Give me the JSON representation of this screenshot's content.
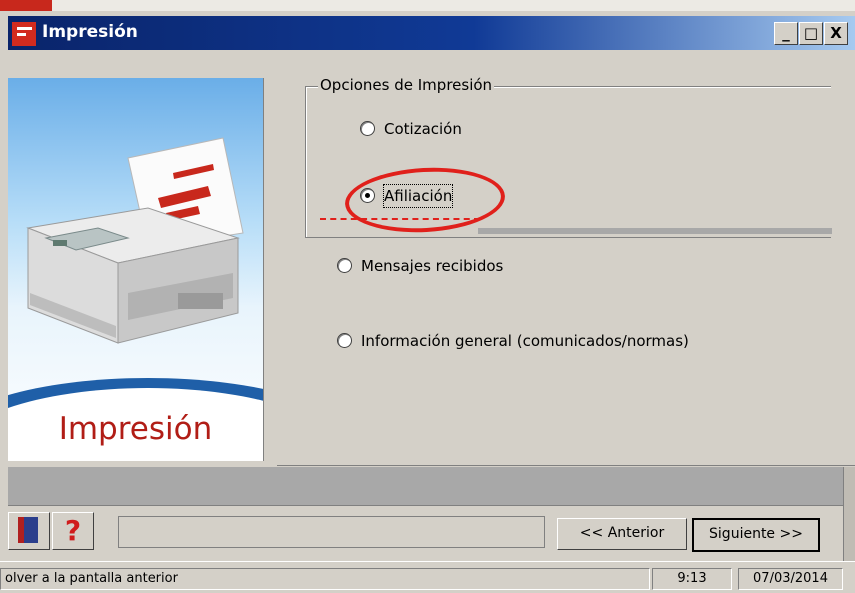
{
  "window": {
    "title": "Impresión",
    "controls": {
      "minimize": "_",
      "maximize": "□",
      "close": "X"
    }
  },
  "side_panel": {
    "title": "Impresión"
  },
  "options_group": {
    "label": "Opciones de Impresión",
    "options": [
      {
        "label": "Cotización",
        "selected": false
      },
      {
        "label": "Afiliación",
        "selected": true
      },
      {
        "label": "Mensajes recibidos",
        "selected": false
      },
      {
        "label": "Información general (comunicados/normas)",
        "selected": false
      }
    ]
  },
  "toolbar": {
    "help_label": "?",
    "prev_label": "<< Anterior",
    "next_label": "Siguiente >>"
  },
  "statusbar": {
    "message": "olver a la pantalla anterior",
    "time": "9:13",
    "date": "07/03/2014"
  },
  "icons": {
    "app": "app-logo-icon",
    "book": "book-icon",
    "help": "help-icon",
    "printer": "printer-illustration"
  },
  "colors": {
    "titlebar": "#0a246a",
    "accent_red": "#d22b1f",
    "window_bg": "#d4d0c8",
    "highlight": "#e0201b"
  }
}
